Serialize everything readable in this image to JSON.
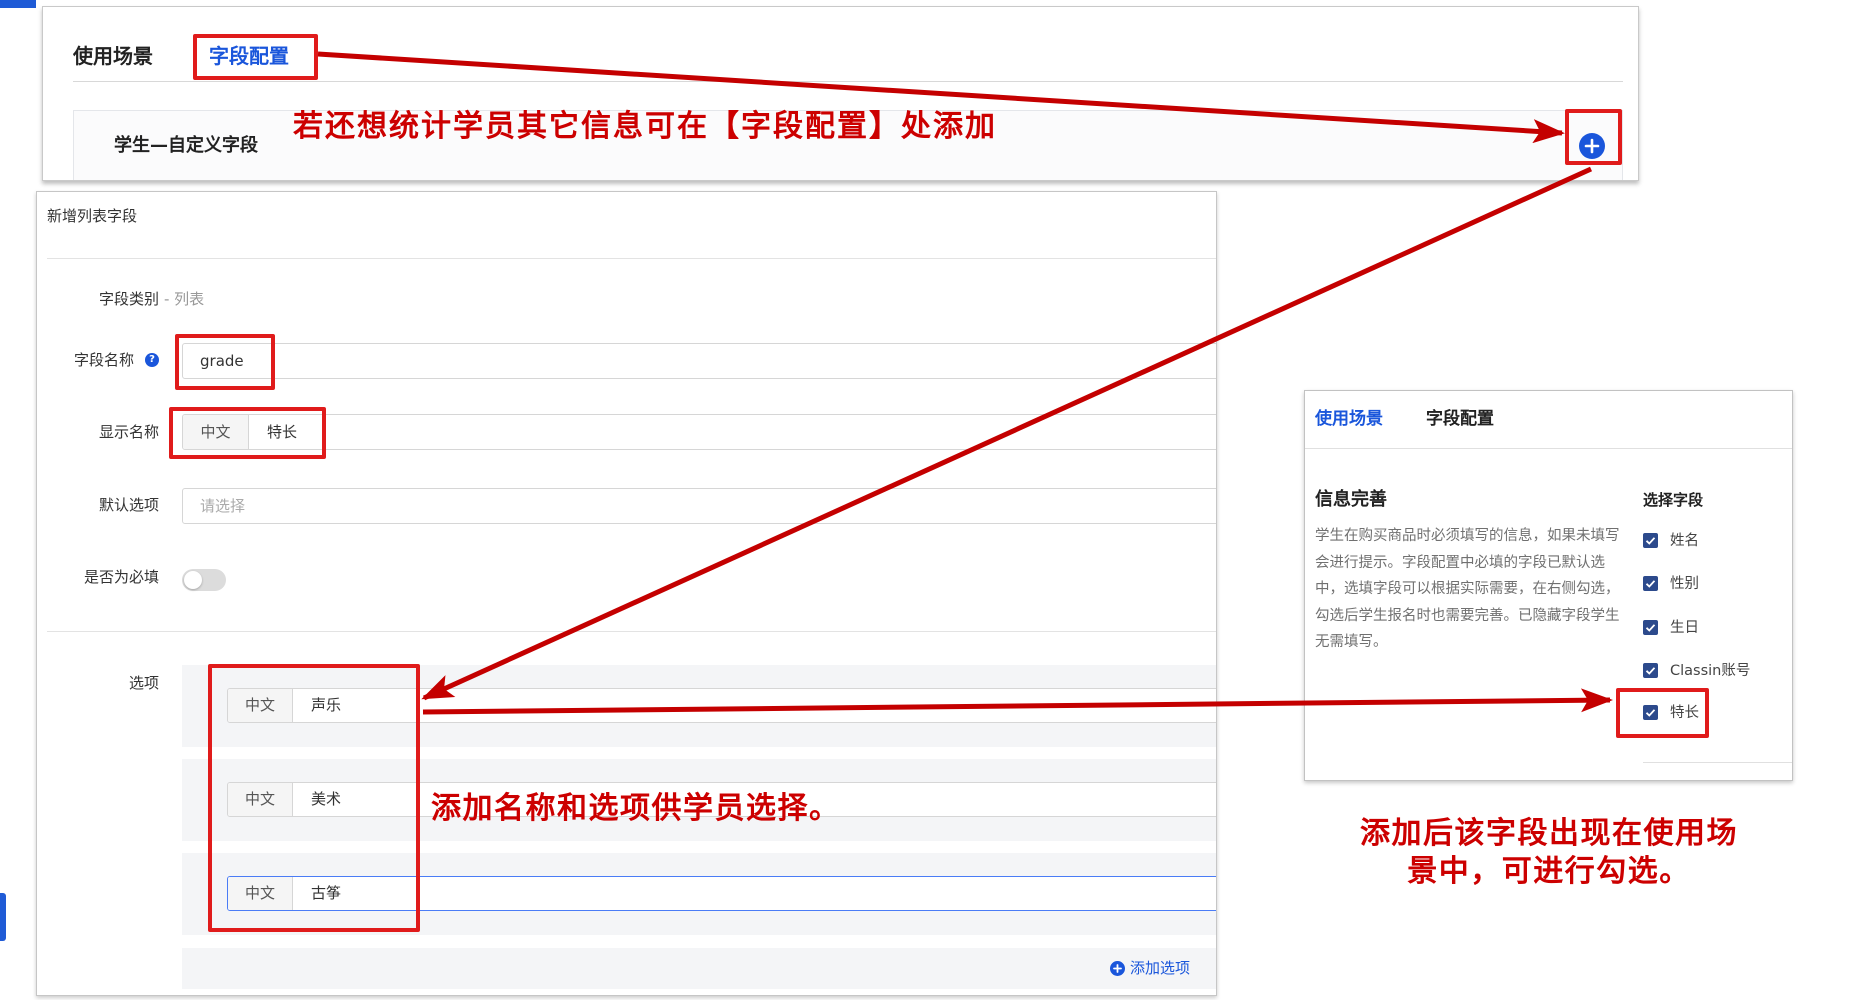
{
  "colors": {
    "accent": "#1a56db",
    "annotation": "#cc0000",
    "annotation_box": "#e01b1b",
    "checkbox": "#2c4a8c",
    "edge_accent": "#1f5bd6"
  },
  "icons": [
    "plus-circle-icon",
    "help-icon",
    "check-icon"
  ],
  "top_panel": {
    "tabs": [
      {
        "label": "使用场景",
        "active": false
      },
      {
        "label": "字段配置",
        "active": true
      }
    ],
    "section_title": "学生—自定义字段"
  },
  "form": {
    "title": "新增列表字段",
    "field_type_label": "字段类别",
    "field_type_value": "- 列表",
    "field_name_label": "字段名称",
    "field_name_value": "grade",
    "display_name_label": "显示名称",
    "display_name_lang": "中文",
    "display_name_value": "特长",
    "default_option_label": "默认选项",
    "default_option_placeholder": "请选择",
    "required_label": "是否为必填",
    "required": false,
    "options_label": "选项",
    "options": [
      {
        "lang": "中文",
        "value": "声乐"
      },
      {
        "lang": "中文",
        "value": "美术"
      },
      {
        "lang": "中文",
        "value": "古筝"
      }
    ],
    "add_option_label": "添加选项"
  },
  "scene_panel": {
    "tabs": [
      {
        "label": "使用场景",
        "active": true
      },
      {
        "label": "字段配置",
        "active": false
      }
    ],
    "section_title": "信息完善",
    "description_lines": [
      "学生在购买商品时必须填写的信息，如果未填写",
      "会进行提示。字段配置中必填的字段已默认选",
      "中，选填字段可以根据实际需要，在右侧勾选，",
      "勾选后学生报名时也需要完善。已隐藏字段学生",
      "无需填写。"
    ],
    "select_fields_label": "选择字段",
    "fields": [
      {
        "label": "姓名",
        "checked": true
      },
      {
        "label": "性别",
        "checked": true
      },
      {
        "label": "生日",
        "checked": true
      },
      {
        "label": "Classin账号",
        "checked": true
      },
      {
        "label": "特长",
        "checked": true
      }
    ]
  },
  "annotations": {
    "top": "若还想统计学员其它信息可在【字段配置】处添加",
    "middle": "添加名称和选项供学员选择。",
    "right_line1": "添加后该字段出现在使用场",
    "right_line2": "景中，可进行勾选。"
  }
}
